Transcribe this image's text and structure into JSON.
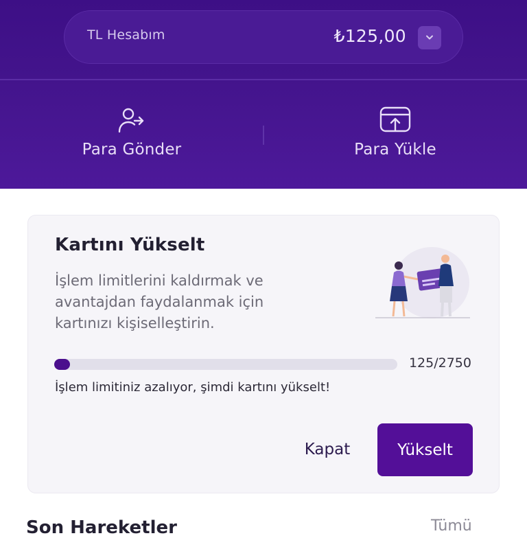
{
  "account": {
    "name": "TL Hesabım",
    "balance": "₺125,00"
  },
  "actions": {
    "send": {
      "label": "Para Gönder",
      "icon": "user-send-icon"
    },
    "load": {
      "label": "Para Yükle",
      "icon": "upload-card-icon"
    }
  },
  "upgrade_card": {
    "title": "Kartını Yükselt",
    "description": "İşlem limitlerini kaldırmak ve avantajdan faydalanmak için kartınızı kişiselleştirin.",
    "progress": {
      "current": 125,
      "total": 2750,
      "text": "125/2750"
    },
    "warning": "İşlem limitiniz azalıyor, şimdi kartını yükselt!",
    "close_label": "Kapat",
    "upgrade_label": "Yükselt"
  },
  "recent": {
    "title": "Son Hareketler",
    "see_all": "Tümü"
  },
  "colors": {
    "header_bg": "#43148c",
    "primary": "#530f98",
    "card_bg": "#f6f5f9"
  }
}
